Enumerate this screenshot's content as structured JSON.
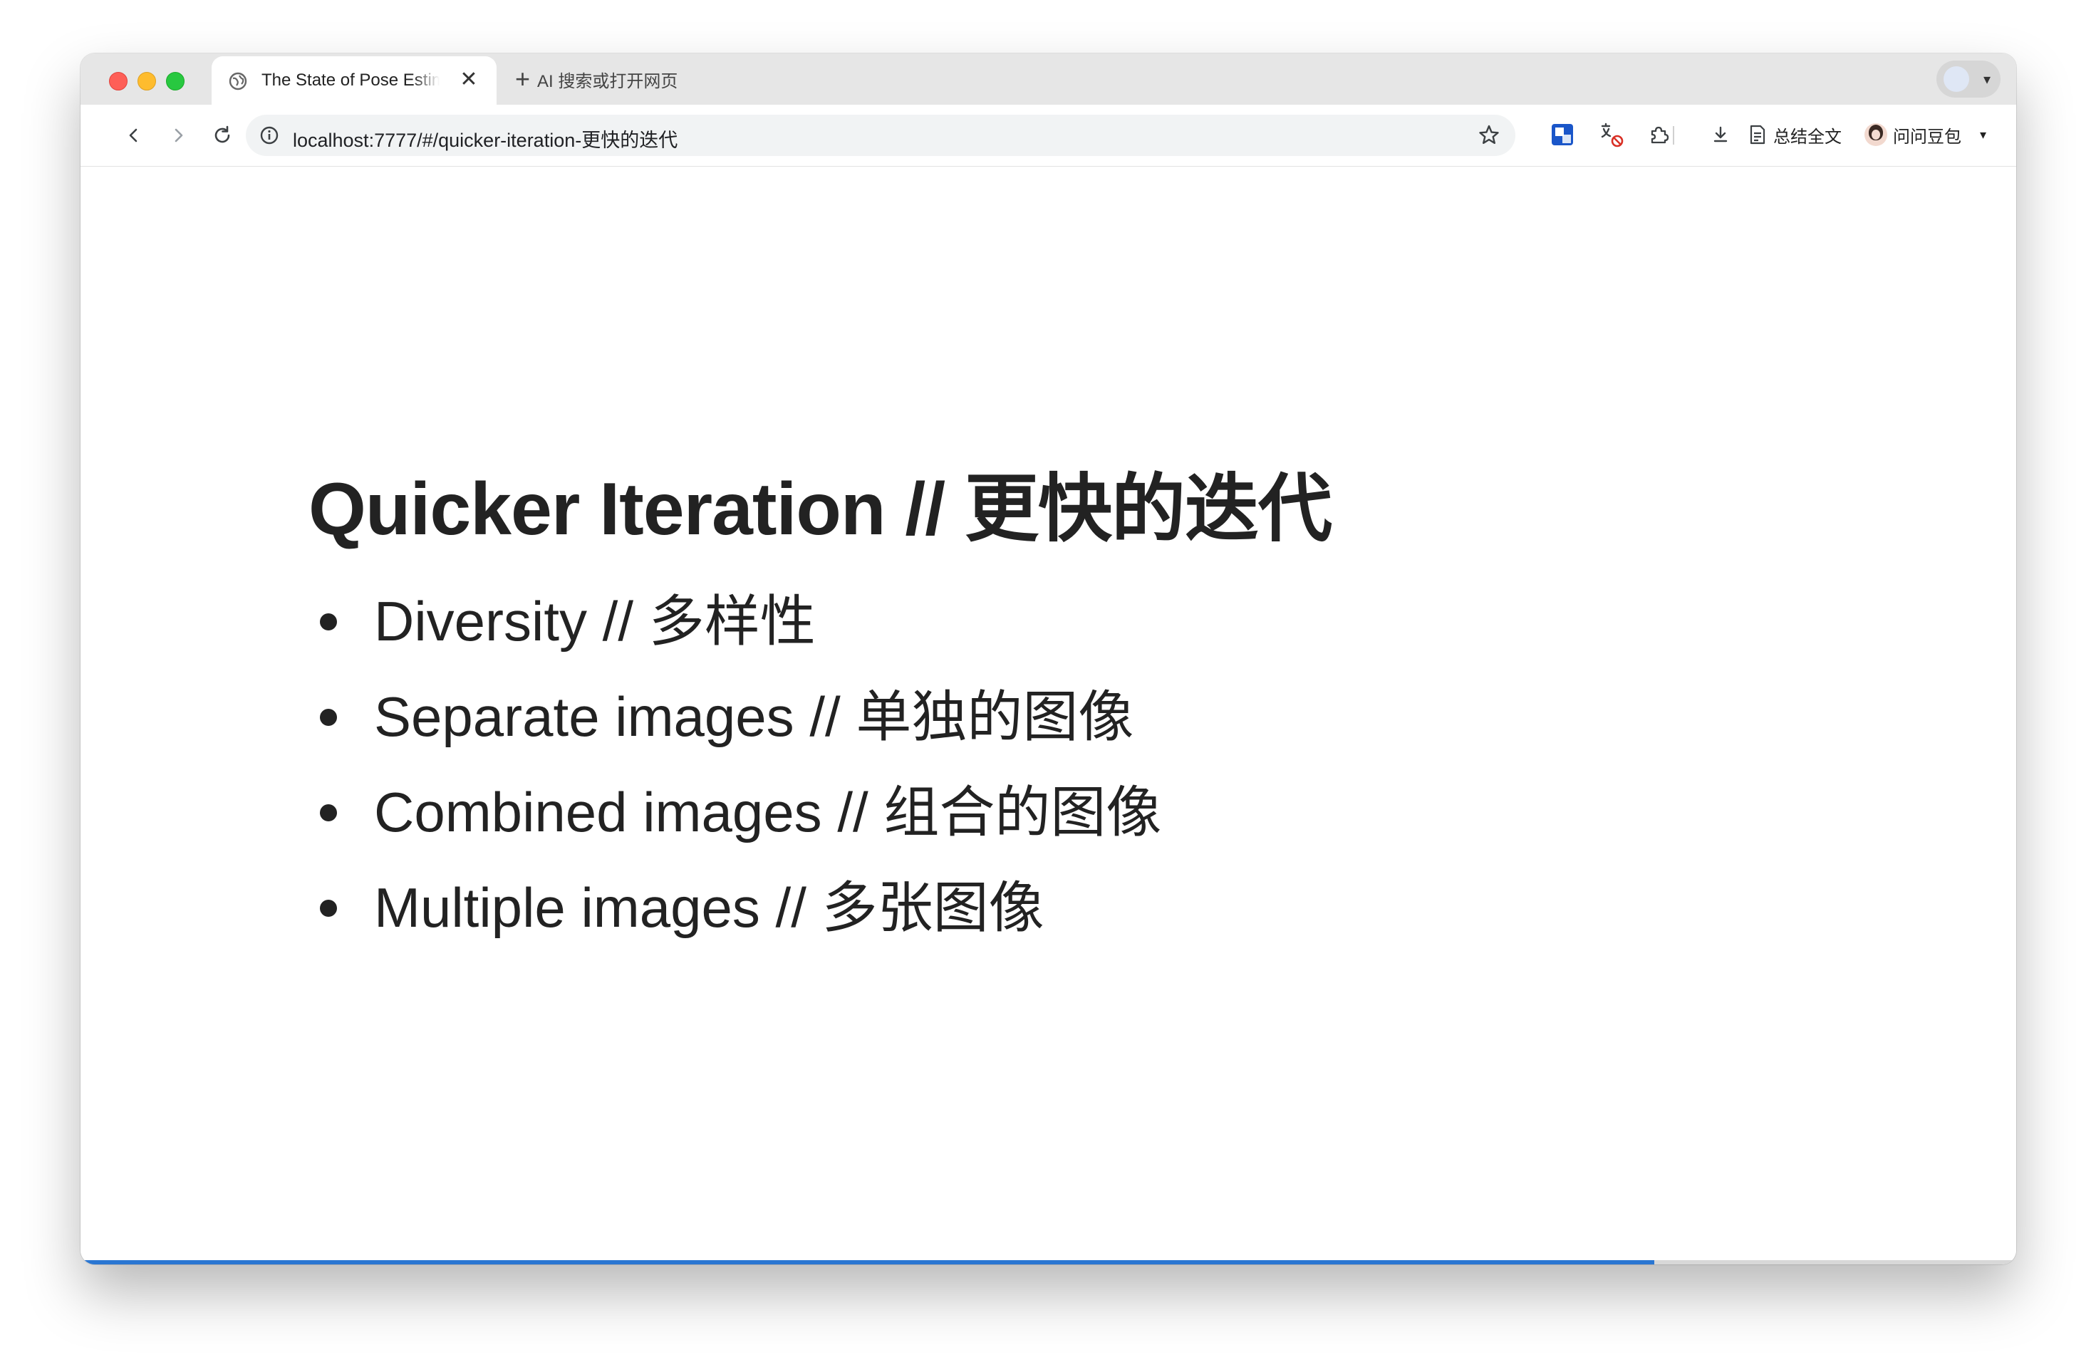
{
  "browser": {
    "tab": {
      "title": "The State of Pose Estimation",
      "close_glyph": "✕"
    },
    "new_tab_label": "AI 搜索或打开网页",
    "address_bar": {
      "url": "localhost:7777/#/quicker-iteration-更快的迭代"
    },
    "toolbar": {
      "summarize_label": "总结全文",
      "assistant_label": "问问豆包"
    }
  },
  "slide": {
    "title": "Quicker Iteration // 更快的迭代",
    "bullets": [
      "Diversity // 多样性",
      "Separate images // 单独的图像",
      "Combined images // 组合的图像",
      "Multiple images // 多张图像"
    ]
  },
  "presentation": {
    "progress_fraction": 0.813
  },
  "colors": {
    "accent": "#2a76d2",
    "text": "#222222"
  }
}
